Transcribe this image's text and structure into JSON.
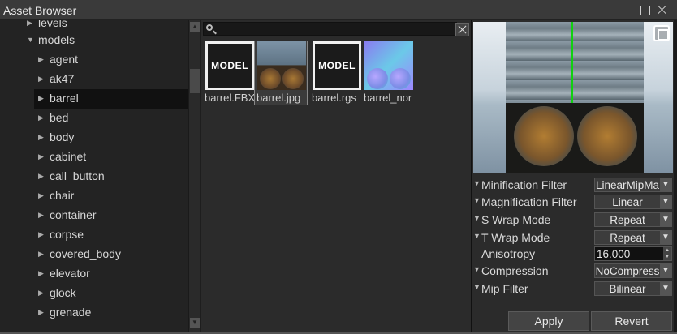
{
  "window": {
    "title": "Asset Browser"
  },
  "tree": {
    "items": [
      {
        "label": "levels",
        "depth": 1,
        "expanded": false
      },
      {
        "label": "models",
        "depth": 1,
        "expanded": true
      },
      {
        "label": "agent",
        "depth": 2,
        "expanded": false
      },
      {
        "label": "ak47",
        "depth": 2,
        "expanded": false
      },
      {
        "label": "barrel",
        "depth": 2,
        "expanded": false,
        "selected": true
      },
      {
        "label": "bed",
        "depth": 2,
        "expanded": false
      },
      {
        "label": "body",
        "depth": 2,
        "expanded": false
      },
      {
        "label": "cabinet",
        "depth": 2,
        "expanded": false
      },
      {
        "label": "call_button",
        "depth": 2,
        "expanded": false
      },
      {
        "label": "chair",
        "depth": 2,
        "expanded": false
      },
      {
        "label": "container",
        "depth": 2,
        "expanded": false
      },
      {
        "label": "corpse",
        "depth": 2,
        "expanded": false
      },
      {
        "label": "covered_body",
        "depth": 2,
        "expanded": false
      },
      {
        "label": "elevator",
        "depth": 2,
        "expanded": false
      },
      {
        "label": "glock",
        "depth": 2,
        "expanded": false
      },
      {
        "label": "grenade",
        "depth": 2,
        "expanded": false
      }
    ]
  },
  "search": {
    "value": "",
    "placeholder": ""
  },
  "assets": [
    {
      "label": "barrel.FBX",
      "thumb": "MODEL",
      "kind": "model"
    },
    {
      "label": "barrel.jpg",
      "kind": "texture",
      "selected": true
    },
    {
      "label": "barrel.rgs",
      "thumb": "MODEL",
      "kind": "model"
    },
    {
      "label": "barrel_nor",
      "kind": "normal-map"
    }
  ],
  "properties": [
    {
      "label": "Minification Filter",
      "value": "LinearMipMa",
      "type": "dropdown"
    },
    {
      "label": "Magnification Filter",
      "value": "Linear",
      "type": "dropdown"
    },
    {
      "label": "S Wrap Mode",
      "value": "Repeat",
      "type": "dropdown"
    },
    {
      "label": "T Wrap Mode",
      "value": "Repeat",
      "type": "dropdown"
    },
    {
      "label": "Anisotropy",
      "value": "16.000",
      "type": "number"
    },
    {
      "label": "Compression",
      "value": "NoCompress",
      "type": "dropdown"
    },
    {
      "label": "Mip Filter",
      "value": "Bilinear",
      "type": "dropdown"
    }
  ],
  "buttons": {
    "apply": "Apply",
    "revert": "Revert"
  },
  "icons": {
    "collapsed": "triangle-right",
    "expanded": "triangle-down",
    "search": "magnifier",
    "clear": "x",
    "expand_preview": "fullscreen"
  },
  "colors": {
    "selection": "#111111",
    "axis_green": "#10d010",
    "axis_red": "#d02020"
  }
}
